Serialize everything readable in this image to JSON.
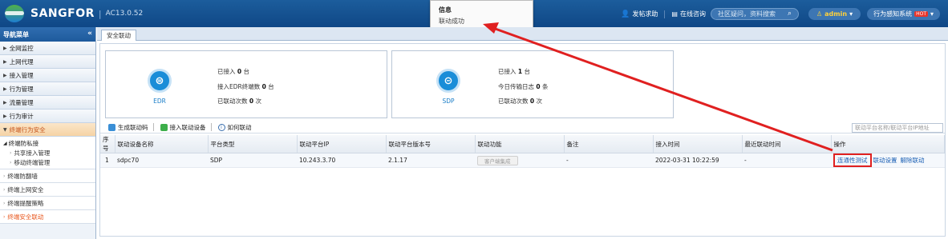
{
  "header": {
    "brand": "SANGFOR",
    "version": "AC13.0.52",
    "help": "发帖求助",
    "consult": "在线咨询",
    "search_placeholder": "社区疑问，资料搜索",
    "user": "admin",
    "system": "行为感知系统",
    "hot": "HOT"
  },
  "popup": {
    "title": "信息",
    "message": "联动成功"
  },
  "sidebar": {
    "title": "导航菜单",
    "collapse": "«",
    "items": [
      "全网监控",
      "上网代理",
      "接入管理",
      "行为管理",
      "流量管理",
      "行为审计"
    ],
    "active": "终端行为安全",
    "group_title": "终端防私接",
    "group_items": [
      "共享接入管理",
      "移动终端管理"
    ],
    "others": [
      "终端防翻墙",
      "终端上网安全",
      "终端提醒策略",
      "终端安全联动"
    ]
  },
  "main": {
    "tab": "安全联动",
    "cards": [
      {
        "label": "EDR",
        "lines": [
          {
            "text": "已接入",
            "value": "0",
            "unit": "台"
          },
          {
            "text": "接入EDR终端数",
            "value": "0",
            "unit": "台"
          },
          {
            "text": "已联动次数",
            "value": "0",
            "unit": "次"
          }
        ]
      },
      {
        "label": "SDP",
        "lines": [
          {
            "text": "已接入",
            "value": "1",
            "unit": "台"
          },
          {
            "text": "今日传输日志",
            "value": "0",
            "unit": "条"
          },
          {
            "text": "已联动次数",
            "value": "0",
            "unit": "次"
          }
        ]
      }
    ],
    "toolbar": {
      "gen_code": "生成联动码",
      "add_device": "接入联动设备",
      "how": "如何联动",
      "search_placeholder": "联动平台名称/联动平台IP地址"
    },
    "columns": [
      "序号",
      "联动设备名称",
      "平台类型",
      "联动平台IP",
      "联动平台版本号",
      "联动功能",
      "备注",
      "接入时间",
      "最近联动时间",
      "操作"
    ],
    "rows": [
      {
        "no": "1",
        "name": "sdpc70",
        "type": "SDP",
        "ip": "10.243.3.70",
        "version": "2.1.17",
        "feature": "客户端集成",
        "note": "-",
        "time": "2022-03-31 10:22:59",
        "last": "-",
        "ops": [
          "连通性测试",
          "联动设置",
          "解除联动"
        ]
      }
    ]
  },
  "colors": {
    "header": "#1c5d9c",
    "accent": "#1a8dd8",
    "annotation": "#e02020"
  }
}
